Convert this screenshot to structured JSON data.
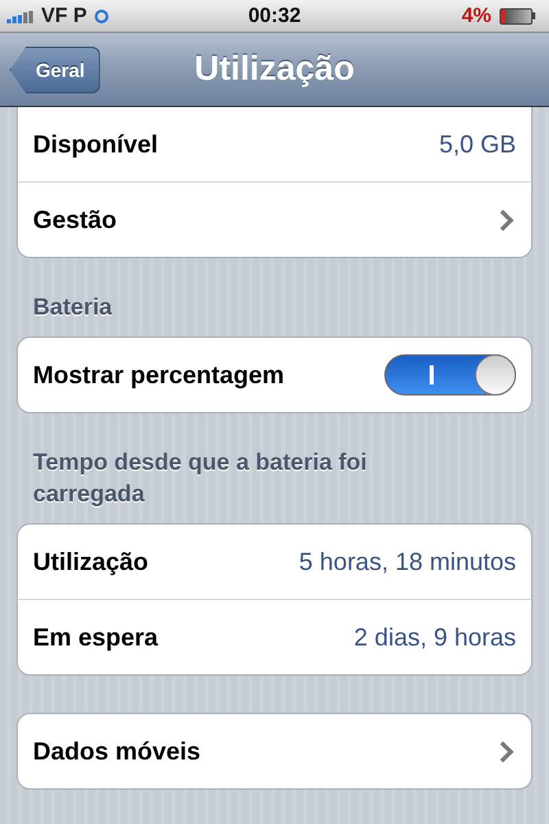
{
  "status_bar": {
    "carrier": "VF P",
    "time": "00:32",
    "battery": "4%"
  },
  "nav_bar": {
    "back": "Geral",
    "title": "Utilização"
  },
  "sections": [
    {
      "rows": [
        {
          "kind": "value",
          "label": "Disponível",
          "value": "5,0 GB"
        },
        {
          "kind": "link",
          "label": "Gestão"
        }
      ]
    },
    {
      "header": "Bateria",
      "rows": [
        {
          "kind": "switch",
          "label": "Mostrar percentagem",
          "on": true
        }
      ]
    },
    {
      "header": "Tempo desde que a bateria foi carregada",
      "rows": [
        {
          "kind": "value",
          "label": "Utilização",
          "value": "5 horas, 18 minutos"
        },
        {
          "kind": "value",
          "label": "Em espera",
          "value": "2 dias, 9 horas"
        }
      ]
    },
    {
      "rows": [
        {
          "kind": "link",
          "label": "Dados móveis"
        }
      ]
    }
  ]
}
